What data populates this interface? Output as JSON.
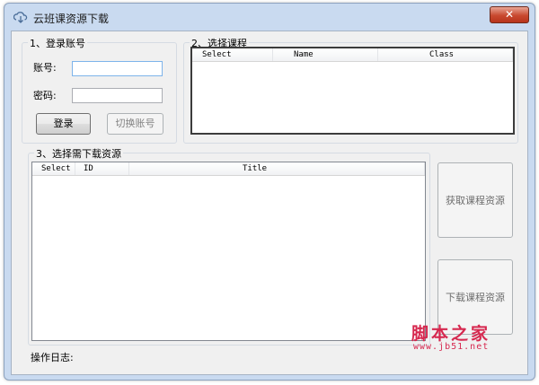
{
  "window": {
    "title": "云班课资源下载",
    "close_label": "✕"
  },
  "login_group": {
    "legend": "1、登录账号",
    "account_label": "账号:",
    "account_value": "",
    "password_label": "密码:",
    "password_value": "",
    "login_button": "登录",
    "switch_button": "切换账号"
  },
  "course_group": {
    "legend": "2、选择课程",
    "columns": [
      "Select",
      "Name",
      "Class"
    ]
  },
  "resource_group": {
    "legend": "3、选择需下载资源",
    "columns": [
      "Select",
      "ID",
      "Title"
    ]
  },
  "actions": {
    "fetch_button": "获取课程资源",
    "download_button": "下载课程资源"
  },
  "log": {
    "label": "操作日志:"
  },
  "watermark": {
    "text": "脚本之家",
    "url": "www.jb51.net"
  },
  "colors": {
    "window_frame": "#c9daf0",
    "client_bg": "#f0f0f0",
    "watermark": "#d6284f"
  }
}
